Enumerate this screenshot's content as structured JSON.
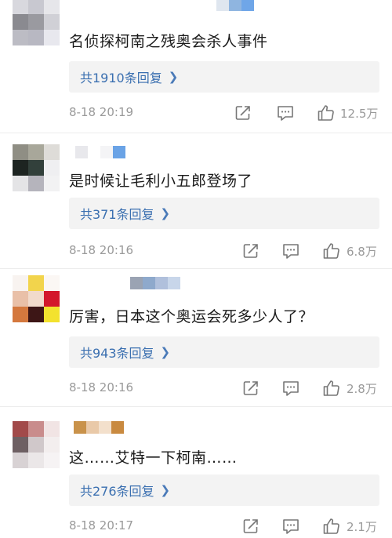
{
  "comments": [
    {
      "text": "名侦探柯南之残奥会杀人事件",
      "replies": "共1910条回复",
      "time": "8-18 20:19",
      "likes": "12.5万",
      "avatar_colors": [
        "#d8d8de",
        "#c8c8d0",
        "#e6e6ea",
        "#8a8a90",
        "#9a9aa0",
        "#d0d0d6",
        "#bcbcc4",
        "#b8b8c2",
        "#e8e8ee"
      ],
      "name_colors": [
        "#ffffff",
        "#dfe6ef",
        "#8fb5e0",
        "#6fa6e8"
      ]
    },
    {
      "text": "是时候让毛利小五郎登场了",
      "replies": "共371条回复",
      "time": "8-18 20:16",
      "likes": "6.8万",
      "avatar_colors": [
        "#8f8e84",
        "#a8a79a",
        "#dedcd8",
        "#1d2421",
        "#32403b",
        "#efeff1",
        "#e4e4e6",
        "#b5b4bc",
        "#f2f2f3"
      ],
      "name_colors": [
        "#e8e8ec",
        "#ffffff",
        "#f4f4f6",
        "#6aa3e6"
      ]
    },
    {
      "text": "厉害，日本这个奥运会死多少人了？",
      "replies": "共943条回复",
      "time": "8-18 20:16",
      "likes": "2.8万",
      "avatar_colors": [
        "#f8f3f0",
        "#f2d44c",
        "#fbf7f4",
        "#e9c0a8",
        "#f1dacb",
        "#d3172b",
        "#d4783e",
        "#3d1616",
        "#f3e22e"
      ],
      "name_colors": [
        "#9aa3b3",
        "#8ea9cc",
        "#b0c0dc",
        "#c8d6ea"
      ]
    },
    {
      "text": "这……艾特一下柯南……",
      "replies": "共276条回复",
      "time": "8-18 20:17",
      "likes": "2.1万",
      "avatar_colors": [
        "#a24a4a",
        "#c98c8c",
        "#f1e4e4",
        "#6e6063",
        "#d0c8ca",
        "#f3eeee",
        "#d8d2d4",
        "#ebe7e8",
        "#f6f3f4"
      ],
      "name_colors": [
        "#c9924a",
        "#e9c9a8",
        "#f3e0cc",
        "#c98a40"
      ]
    }
  ],
  "colors": {
    "link": "#3a6fb0",
    "meta": "#9a9a9a",
    "reply_bg": "#f3f3f3"
  },
  "icons": [
    "share-icon",
    "comment-icon",
    "like-icon"
  ]
}
